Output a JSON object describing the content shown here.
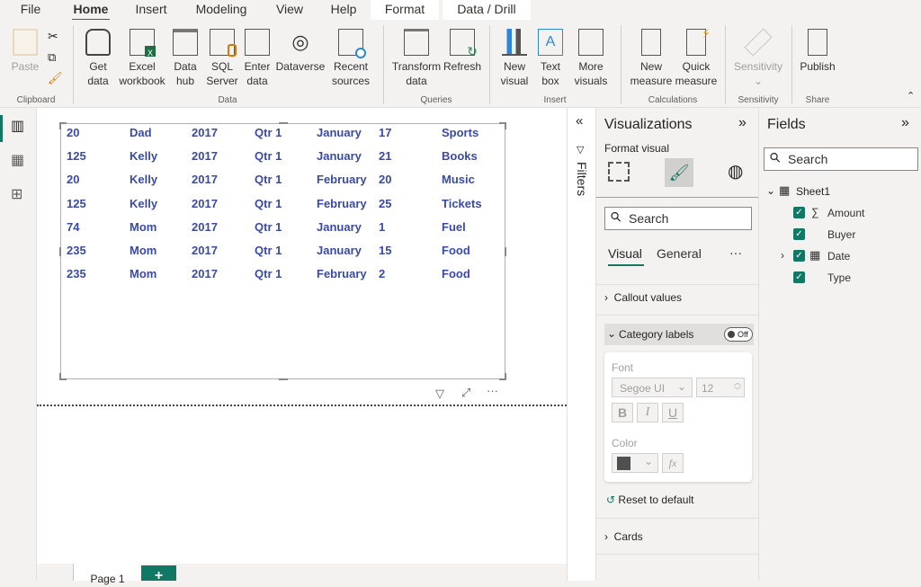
{
  "tabs": [
    "File",
    "Home",
    "Insert",
    "Modeling",
    "View",
    "Help",
    "Format",
    "Data / Drill"
  ],
  "ribbon": {
    "clipboard": {
      "paste": "Paste",
      "group": "Clipboard"
    },
    "data": {
      "get_data": [
        "Get",
        "data"
      ],
      "excel": [
        "Excel",
        "workbook"
      ],
      "data_hub": [
        "Data",
        "hub"
      ],
      "sql": [
        "SQL",
        "Server"
      ],
      "enter": [
        "Enter",
        "data"
      ],
      "dataverse": "Dataverse",
      "recent": [
        "Recent",
        "sources"
      ],
      "group": "Data"
    },
    "queries": {
      "transform": [
        "Transform",
        "data"
      ],
      "refresh": "Refresh",
      "group": "Queries"
    },
    "insert": {
      "new_visual": [
        "New",
        "visual"
      ],
      "text_box": [
        "Text",
        "box"
      ],
      "more": [
        "More",
        "visuals"
      ],
      "group": "Insert"
    },
    "calculations": {
      "new_measure": [
        "New",
        "measure"
      ],
      "quick_measure": [
        "Quick",
        "measure"
      ],
      "group": "Calculations"
    },
    "sensitivity": {
      "label": "Sensitivity",
      "group": "Sensitivity"
    },
    "share": {
      "publish": "Publish",
      "group": "Share"
    }
  },
  "table": {
    "rows": [
      [
        "20",
        "Dad",
        "2017",
        "Qtr 1",
        "January",
        "17",
        "Sports"
      ],
      [
        "125",
        "Kelly",
        "2017",
        "Qtr 1",
        "January",
        "21",
        "Books"
      ],
      [
        "20",
        "Kelly",
        "2017",
        "Qtr 1",
        "February",
        "20",
        "Music"
      ],
      [
        "125",
        "Kelly",
        "2017",
        "Qtr 1",
        "February",
        "25",
        "Tickets"
      ],
      [
        "74",
        "Mom",
        "2017",
        "Qtr 1",
        "January",
        "1",
        "Fuel"
      ],
      [
        "235",
        "Mom",
        "2017",
        "Qtr 1",
        "January",
        "15",
        "Food"
      ],
      [
        "235",
        "Mom",
        "2017",
        "Qtr 1",
        "February",
        "2",
        "Food"
      ]
    ],
    "text_color": "#3a4aa8"
  },
  "pages": {
    "page1": "Page 1",
    "add": "+"
  },
  "filters": {
    "label": "Filters"
  },
  "viz": {
    "title": "Visualizations",
    "format_visual": "Format visual",
    "search_placeholder": "Search",
    "tab_visual": "Visual",
    "tab_general": "General",
    "more": "···",
    "callout": "Callout values",
    "category": "Category labels",
    "toggle": "Off",
    "font_label": "Font",
    "font_value": "Segoe UI",
    "font_size": "12",
    "bold": "B",
    "italic": "I",
    "underline": "U",
    "color_label": "Color",
    "color_value": "#505050",
    "fx": "fx",
    "reset": "Reset to default",
    "cards": "Cards"
  },
  "fields": {
    "title": "Fields",
    "search_placeholder": "Search",
    "table": "Sheet1",
    "items": [
      "Amount",
      "Buyer",
      "Date",
      "Type"
    ]
  },
  "accent": "#117865"
}
